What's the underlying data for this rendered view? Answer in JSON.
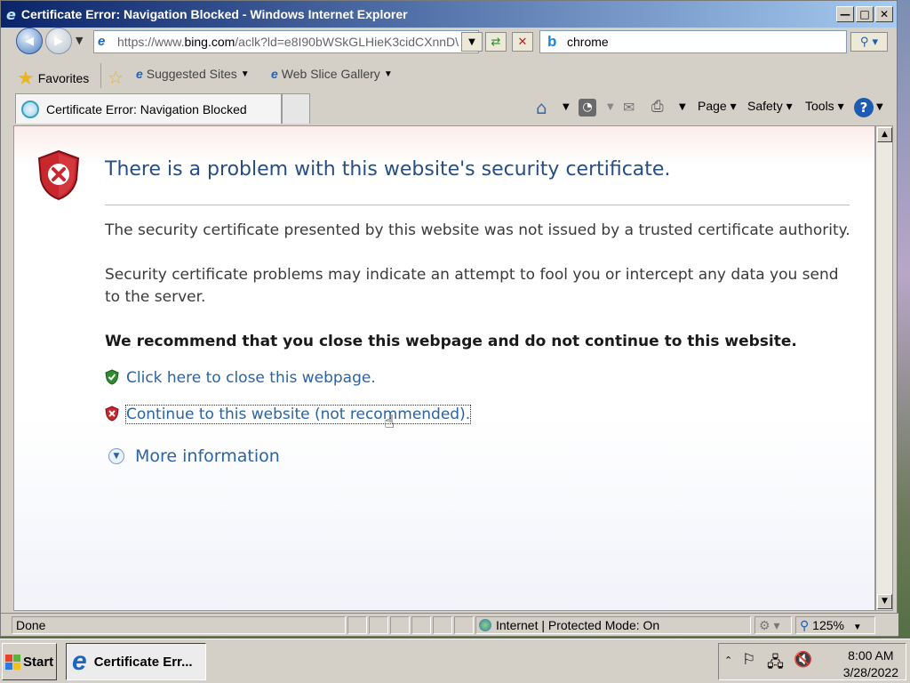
{
  "window": {
    "title": "Certificate Error: Navigation Blocked - Windows Internet Explorer",
    "min": "—",
    "max": "□",
    "close": "✕"
  },
  "address": {
    "prefix": "https://www.",
    "domain": "bing.com",
    "rest": "/aclk?ld=e8I90bWSkGLHieK3cidCXnnD\\"
  },
  "search": {
    "value": "chrome"
  },
  "favorites": {
    "label": "Favorites",
    "suggested": "Suggested Sites",
    "webslice": "Web Slice Gallery"
  },
  "tab": {
    "label": "Certificate Error: Navigation Blocked"
  },
  "commands": {
    "page": "Page",
    "safety": "Safety",
    "tools": "Tools"
  },
  "content": {
    "heading": "There is a problem with this website's security certificate.",
    "p1": "The security certificate presented by this website was not issued by a trusted certificate authority.",
    "p2": "Security certificate problems may indicate an attempt to fool you or intercept any data you send to the server.",
    "p3": "We recommend that you close this webpage and do not continue to this website.",
    "close_link": "Click here to close this webpage.",
    "continue_link": "Continue to this website (not recommended).",
    "more_info": "More information"
  },
  "status": {
    "left": "Done",
    "zone": "Internet | Protected Mode: On",
    "zoom": "125%"
  },
  "taskbar": {
    "start": "Start",
    "task": "Certificate Err...",
    "time": "8:00 AM",
    "date": "3/28/2022"
  }
}
